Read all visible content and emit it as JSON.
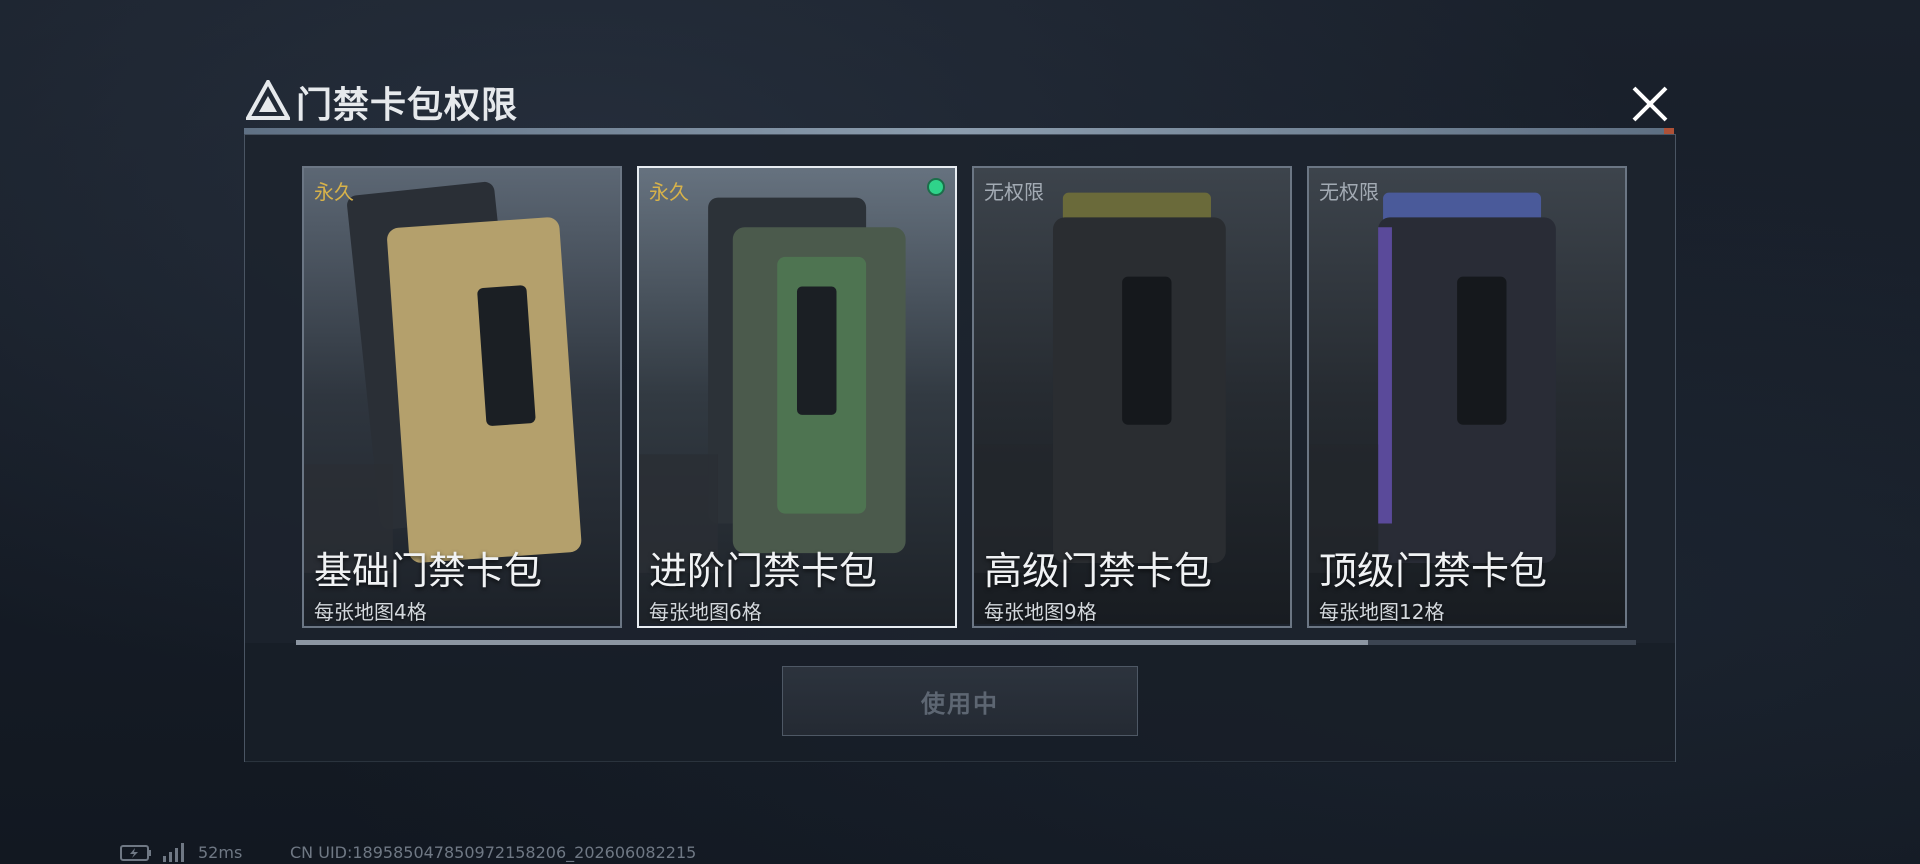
{
  "header": {
    "title": "门禁卡包权限",
    "close_icon": "close-icon",
    "logo_icon": "triangle-logo-icon"
  },
  "cards": [
    {
      "status": "永久",
      "status_color": "#d7b24a",
      "name": "基础门禁卡包",
      "desc": "每张地图4格",
      "selected": false,
      "accent": "#b8a06a"
    },
    {
      "status": "永久",
      "status_color": "#d7b24a",
      "name": "进阶门禁卡包",
      "desc": "每张地图6格",
      "selected": true,
      "accent": "#4f7a52"
    },
    {
      "status": "无权限",
      "status_color": "#a3abb4",
      "name": "高级门禁卡包",
      "desc": "每张地图9格",
      "selected": false,
      "accent": "#6a6a3a"
    },
    {
      "status": "无权限",
      "status_color": "#a3abb4",
      "name": "顶级门禁卡包",
      "desc": "每张地图12格",
      "selected": false,
      "accent": "#4a4a8a"
    }
  ],
  "scroll": {
    "position": 0.8
  },
  "action": {
    "label": "使用中"
  },
  "footer": {
    "ping": "52ms",
    "uid": "CN UID:18958504785097215820​6_202606082215"
  },
  "colors": {
    "selected_dot": "#2fd38a",
    "gold": "#d7b24a"
  }
}
